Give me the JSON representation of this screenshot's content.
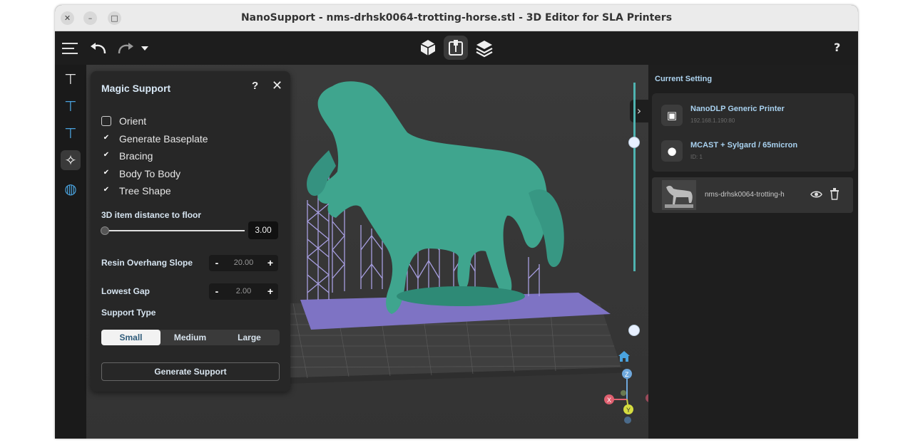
{
  "window": {
    "title": "NanoSupport - nms-drhsk0064-trotting-horse.stl - 3D Editor for SLA Printers",
    "close_glyph": "✕",
    "minimize_glyph": "–",
    "maximize_glyph": "□"
  },
  "toolbar": {
    "help_label": "?"
  },
  "magic_support": {
    "title": "Magic Support",
    "help_label": "?",
    "close_glyph": "✕",
    "options": [
      {
        "label": "Orient",
        "checked": false
      },
      {
        "label": "Generate Baseplate",
        "checked": true
      },
      {
        "label": "Bracing",
        "checked": true
      },
      {
        "label": "Body To Body",
        "checked": true
      },
      {
        "label": "Tree Shape",
        "checked": true
      }
    ],
    "distance_label": "3D item distance to floor",
    "distance_value": "3.00",
    "overhang_label": "Resin Overhang Slope",
    "overhang_value": "20.00",
    "gap_label": "Lowest Gap",
    "gap_value": "2.00",
    "minus": "-",
    "plus": "+",
    "support_type_label": "Support Type",
    "support_types": [
      "Small",
      "Medium",
      "Large"
    ],
    "support_type_selected": "Small",
    "generate_label": "Generate Support"
  },
  "right_panel": {
    "header": "Current Setting",
    "printer_name": "NanoDLP Generic Printer",
    "printer_ip": "192.168.1.190:80",
    "resin_name": "MCAST + Sylgard / 65micron",
    "resin_id": "ID: 1",
    "object_name": "nms-drhsk0064-trotting-h"
  },
  "axes": {
    "x": "X",
    "y": "Y",
    "z": "Z"
  },
  "colors": {
    "model": "#3fa58e",
    "supports": "#8a80c8",
    "accent": "#4aa3df",
    "slider": "#4fb3b0"
  }
}
